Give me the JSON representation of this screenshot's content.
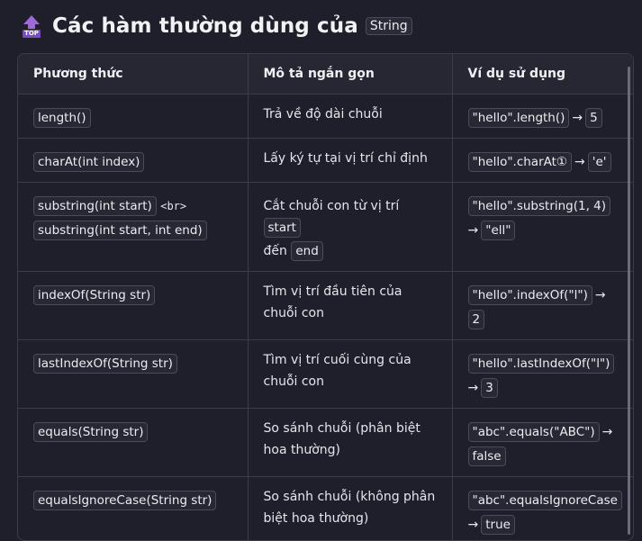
{
  "heading": {
    "icon": "top-arrow-icon",
    "icon_label": "TOP",
    "title": "Các hàm thường dùng của",
    "code": "String"
  },
  "table": {
    "headers": [
      "Phương thức",
      "Mô tả ngắn gọn",
      "Ví dụ sử dụng"
    ],
    "rows": [
      {
        "method": "length()",
        "desc": "Trả về độ dài chuỗi",
        "ex_code": "\"hello\".length()",
        "ex_arrow": "→",
        "ex_result": "5"
      },
      {
        "method": "charAt(int index)",
        "desc": "Lấy ký tự tại vị trí chỉ định",
        "ex_code": "\"hello\".charAt①",
        "ex_arrow": "→",
        "ex_result": "'e'"
      },
      {
        "method": "substring(int start)",
        "method_sep": "<br>",
        "method2": "substring(int start, int end)",
        "desc_pre": "Cắt chuỗi con từ vị trí",
        "desc_code1": "start",
        "desc_mid": "đến",
        "desc_code2": "end",
        "ex_code": "\"hello\".substring(1, 4)",
        "ex_arrow": "→",
        "ex_result": "\"ell\""
      },
      {
        "method": "indexOf(String str)",
        "desc": "Tìm vị trí đầu tiên của chuỗi con",
        "ex_code": "\"hello\".indexOf(\"l\")",
        "ex_arrow": "→",
        "ex_result": "2"
      },
      {
        "method": "lastIndexOf(String str)",
        "desc": "Tìm vị trí cuối cùng của chuỗi con",
        "ex_code": "\"hello\".lastIndexOf(\"l\")",
        "ex_arrow": "→",
        "ex_result": "3"
      },
      {
        "method": "equals(String str)",
        "desc": "So sánh chuỗi (phân biệt hoa thường)",
        "ex_code": "\"abc\".equals(\"ABC\")",
        "ex_arrow": "→",
        "ex_result": "false"
      },
      {
        "method": "equalsIgnoreCase(String str)",
        "desc": "So sánh chuỗi (không phân biệt hoa thường)",
        "ex_code": "\"abc\".equalsIgnoreCase",
        "ex_arrow": "→",
        "ex_result": "true"
      }
    ]
  }
}
